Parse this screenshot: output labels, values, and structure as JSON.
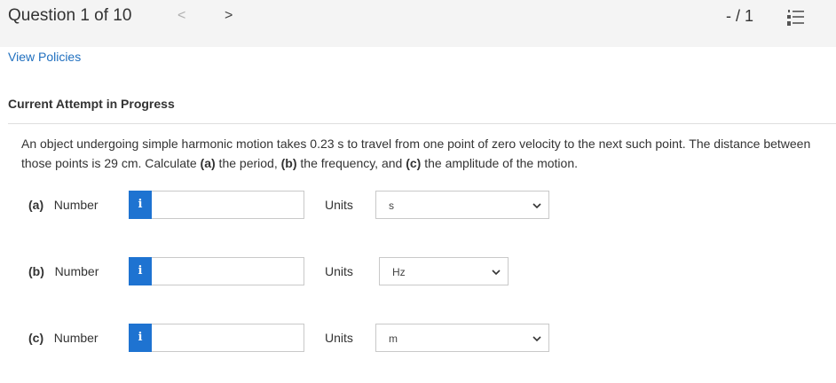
{
  "header": {
    "question_title": "Question 1 of 10",
    "prev_icon": "<",
    "next_icon": ">",
    "score": "- / 1",
    "list_icon_name": "numbered-list-icon"
  },
  "links": {
    "view_policies": "View Policies"
  },
  "attempt_heading": "Current Attempt in Progress",
  "question": {
    "text_1": "An object undergoing simple harmonic motion takes 0.23 s to travel from one point of zero velocity to the next such point. The distance between those points is 29 cm. Calculate ",
    "bold_a": "(a)",
    "text_2": " the period, ",
    "bold_b": "(b)",
    "text_3": " the frequency, and ",
    "bold_c": "(c)",
    "text_4": " the amplitude of the motion."
  },
  "parts": [
    {
      "label": "(a)",
      "field_label": "Number",
      "info": "i",
      "value": "",
      "units_label": "Units",
      "unit": "s"
    },
    {
      "label": "(b)",
      "field_label": "Number",
      "info": "i",
      "value": "",
      "units_label": "Units",
      "unit": "Hz"
    },
    {
      "label": "(c)",
      "field_label": "Number",
      "info": "i",
      "value": "",
      "units_label": "Units",
      "unit": "m"
    }
  ],
  "colors": {
    "accent": "#1e73d1",
    "link": "#1f6fbf",
    "topbar": "#f4f4f4"
  }
}
